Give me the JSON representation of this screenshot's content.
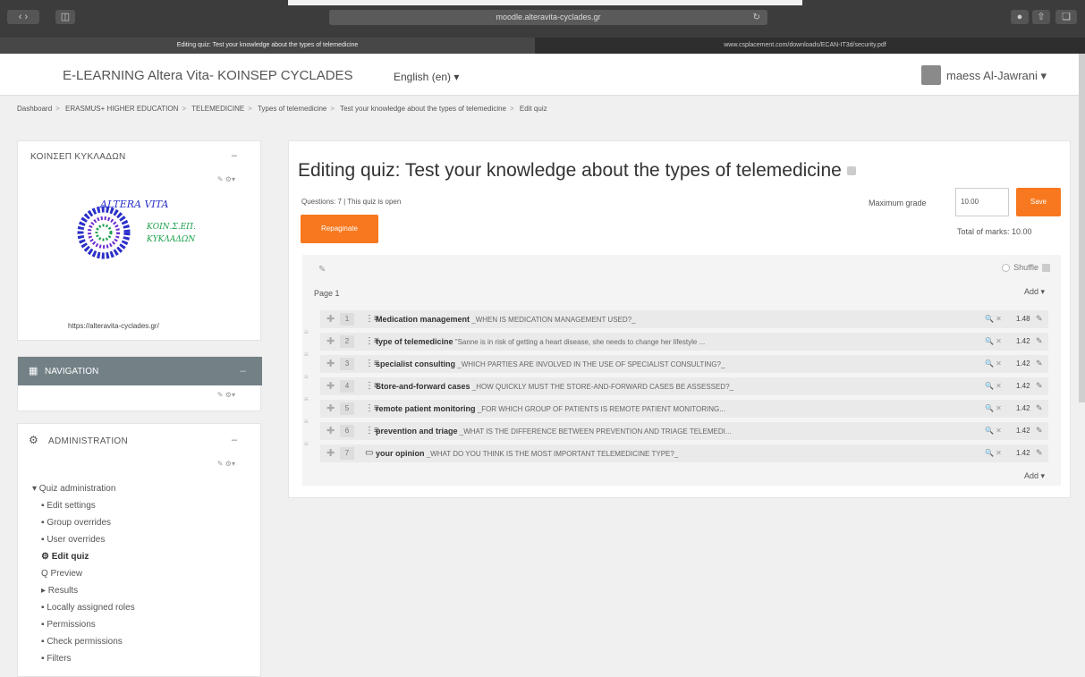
{
  "browser": {
    "url": "moodle.alteravita-cyclades.gr",
    "tabs": [
      {
        "label": "Editing quiz: Test your knowledge about the types of telemedicine"
      },
      {
        "label": "www.csplacement.com/downloads/ECAN-IT3d/security.pdf"
      }
    ]
  },
  "header": {
    "site_title": "E-LEARNING Altera Vita- KOINSEP CYCLADES",
    "language": "English (en) ▾",
    "user": "maess Al-Jawrani ▾"
  },
  "breadcrumb": [
    "Dashboard",
    "ERASMUS+ HIGHER EDUCATION",
    "TELEMEDICINE",
    "Types of telemedicine",
    "Test your knowledge about the types of telemedicine",
    "Edit quiz"
  ],
  "blocks": {
    "koinsep": {
      "title": "ΚΟΙΝΣΕΠ ΚΥΚΛΑΔΩΝ",
      "url": "https://alteravita-cyclades.gr/",
      "logo_text_1": "ALTERA VITA",
      "logo_text_2": "ΚΟΙΝ.Σ.ΕΠ.",
      "logo_text_3": "ΚΥΚΛΑΔΩΝ"
    },
    "navigation": {
      "title": "NAVIGATION"
    },
    "administration": {
      "title": "ADMINISTRATION",
      "items": [
        "▾ Quiz administration",
        "▪ Edit settings",
        "▪ Group overrides",
        "▪ User overrides",
        "⚙ Edit quiz",
        "Q Preview",
        "▸ Results",
        "▪ Locally assigned roles",
        "▪ Permissions",
        "▪ Check permissions",
        "▪ Filters"
      ]
    }
  },
  "main": {
    "title": "Editing quiz: Test your knowledge about the types of telemedicine",
    "info": "Questions: 7 | This quiz is open",
    "repaginate": "Repaginate",
    "max_grade_label": "Maximum grade",
    "max_grade_value": "10.00",
    "save": "Save",
    "total_marks": "Total of marks: 10.00",
    "shuffle": "Shuffle",
    "page_label": "Page 1",
    "add": "Add ▾",
    "questions": [
      {
        "num": "1",
        "name": "Medication management",
        "text": " _WHEN IS MEDICATION MANAGEMENT USED?_",
        "mark": "1.48",
        "type": "multichoice"
      },
      {
        "num": "2",
        "name": "type of telemedicine",
        "text": " \"Sanne is in risk of getting a heart disease, she needs to change her lifestyle ...",
        "mark": "1.42",
        "type": "multichoice"
      },
      {
        "num": "3",
        "name": "specialist consulting",
        "text": " _WHICH PARTIES ARE INVOLVED IN THE USE OF SPECIALIST CONSULTING?_",
        "mark": "1.42",
        "type": "multichoice"
      },
      {
        "num": "4",
        "name": "Store-and-forward cases",
        "text": " _HOW QUICKLY MUST THE STORE-AND-FORWARD CASES BE ASSESSED?_",
        "mark": "1.42",
        "type": "multichoice"
      },
      {
        "num": "5",
        "name": "remote patient monitoring",
        "text": " _FOR WHICH GROUP OF PATIENTS IS REMOTE PATIENT MONITORING...",
        "mark": "1.42",
        "type": "multichoice"
      },
      {
        "num": "6",
        "name": "prevention and triage",
        "text": " _WHAT IS THE DIFFERENCE BETWEEN PREVENTION AND TRIAGE TELEMEDI...",
        "mark": "1.42",
        "type": "multichoice"
      },
      {
        "num": "7",
        "name": "your opinion",
        "text": " _WHAT DO YOU THINK IS THE MOST IMPORTANT TELEMEDICINE TYPE?_",
        "mark": "1.42",
        "type": "shortanswer"
      }
    ]
  },
  "colors": {
    "accent": "#f7781e",
    "nav_header": "#738086"
  }
}
